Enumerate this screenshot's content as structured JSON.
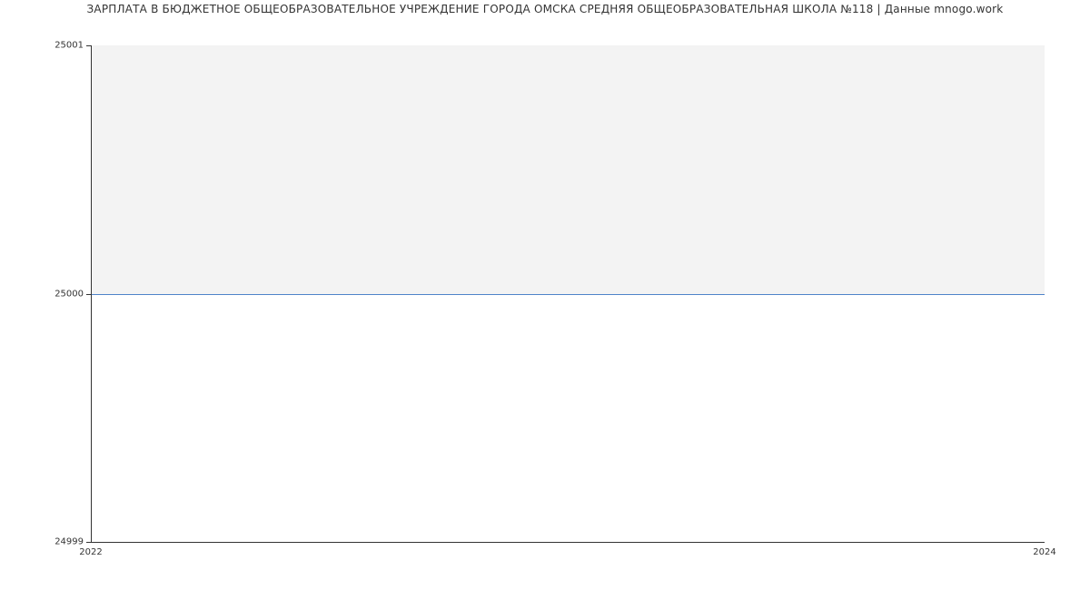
{
  "chart_data": {
    "type": "area",
    "title": "ЗАРПЛАТА В БЮДЖЕТНОЕ ОБЩЕОБРАЗОВАТЕЛЬНОЕ УЧРЕЖДЕНИЕ ГОРОДА ОМСКА СРЕДНЯЯ ОБЩЕОБРАЗОВАТЕЛЬНАЯ ШКОЛА №118 | Данные mnogo.work",
    "x": [
      2022,
      2024
    ],
    "values": [
      25000,
      25000
    ],
    "xlabel": "",
    "ylabel": "",
    "xlim": [
      2022,
      2024
    ],
    "ylim": [
      24999,
      25001
    ],
    "xticks": [
      {
        "value": 2022,
        "label": "2022"
      },
      {
        "value": 2024,
        "label": "2024"
      }
    ],
    "yticks": [
      {
        "value": 24999,
        "label": "24999"
      },
      {
        "value": 25000,
        "label": "25000"
      },
      {
        "value": 25001,
        "label": "25001"
      }
    ],
    "line_color": "#4f83c9",
    "fill_color": "#f3f3f3"
  }
}
